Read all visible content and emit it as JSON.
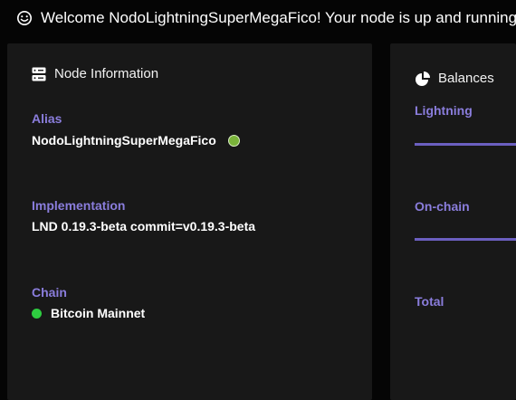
{
  "welcome": {
    "icon": "smile-icon",
    "text": "Welcome NodoLightningSuperMegaFico! Your node is up and running."
  },
  "node_info": {
    "title": "Node Information",
    "icon": "server-icon",
    "alias_label": "Alias",
    "alias_value": "NodoLightningSuperMegaFico",
    "alias_status_color": "#7ab33a",
    "implementation_label": "Implementation",
    "implementation_value": "LND 0.19.3-beta commit=v0.19.3-beta",
    "chain_label": "Chain",
    "chain_value": "Bitcoin Mainnet",
    "chain_status_color": "#2ecc40"
  },
  "balances": {
    "title": "Balances",
    "icon": "pie-chart-icon",
    "lightning_label": "Lightning",
    "onchain_label": "On-chain",
    "total_label": "Total"
  },
  "colors": {
    "accent": "#8a7ddc",
    "card_bg": "#181818",
    "page_bg": "#050505"
  }
}
